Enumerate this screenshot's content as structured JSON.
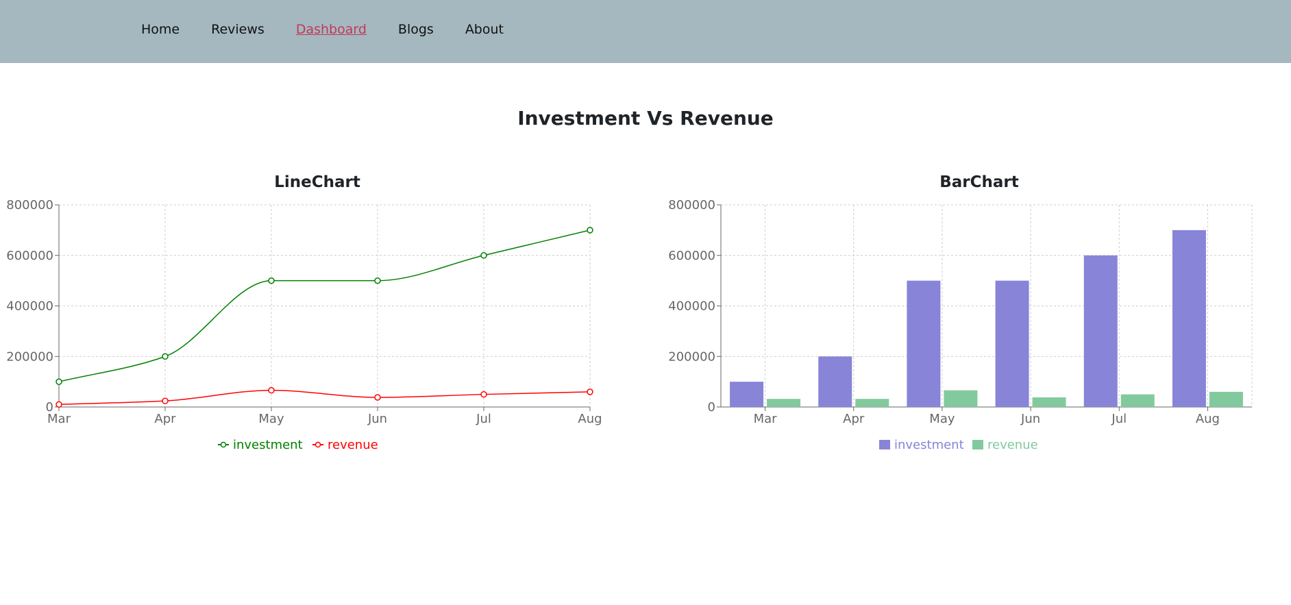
{
  "nav": {
    "items": [
      "Home",
      "Reviews",
      "Dashboard",
      "Blogs",
      "About"
    ],
    "active": "Dashboard"
  },
  "page_title": "Investment Vs Revenue",
  "colors": {
    "investment_line": "#008000",
    "revenue_line": "#ff0000",
    "investment_bar": "#8884d8",
    "revenue_bar": "#82ca9d",
    "nav_bg": "#a5b8bf",
    "active_link": "#c0395a"
  },
  "chart_data": [
    {
      "type": "line",
      "title": "LineChart",
      "categories": [
        "Mar",
        "Apr",
        "May",
        "Jun",
        "Jul",
        "Aug"
      ],
      "series": [
        {
          "name": "investment",
          "values": [
            100000,
            200000,
            500000,
            500000,
            600000,
            700000
          ]
        },
        {
          "name": "revenue",
          "values": [
            10000,
            24000,
            66000,
            38000,
            50000,
            60000
          ]
        }
      ],
      "ylim": [
        0,
        800000
      ],
      "yticks": [
        0,
        200000,
        400000,
        600000,
        800000
      ],
      "grid": true,
      "legend": "bottom-center"
    },
    {
      "type": "bar",
      "title": "BarChart",
      "categories": [
        "Mar",
        "Apr",
        "May",
        "Jun",
        "Jul",
        "Aug"
      ],
      "series": [
        {
          "name": "investment",
          "values": [
            100000,
            200000,
            500000,
            500000,
            600000,
            700000
          ]
        },
        {
          "name": "revenue",
          "values": [
            32000,
            32000,
            66000,
            38000,
            50000,
            60000
          ]
        }
      ],
      "ylim": [
        0,
        800000
      ],
      "yticks": [
        0,
        200000,
        400000,
        600000,
        800000
      ],
      "grid": true,
      "legend": "bottom-center"
    }
  ]
}
